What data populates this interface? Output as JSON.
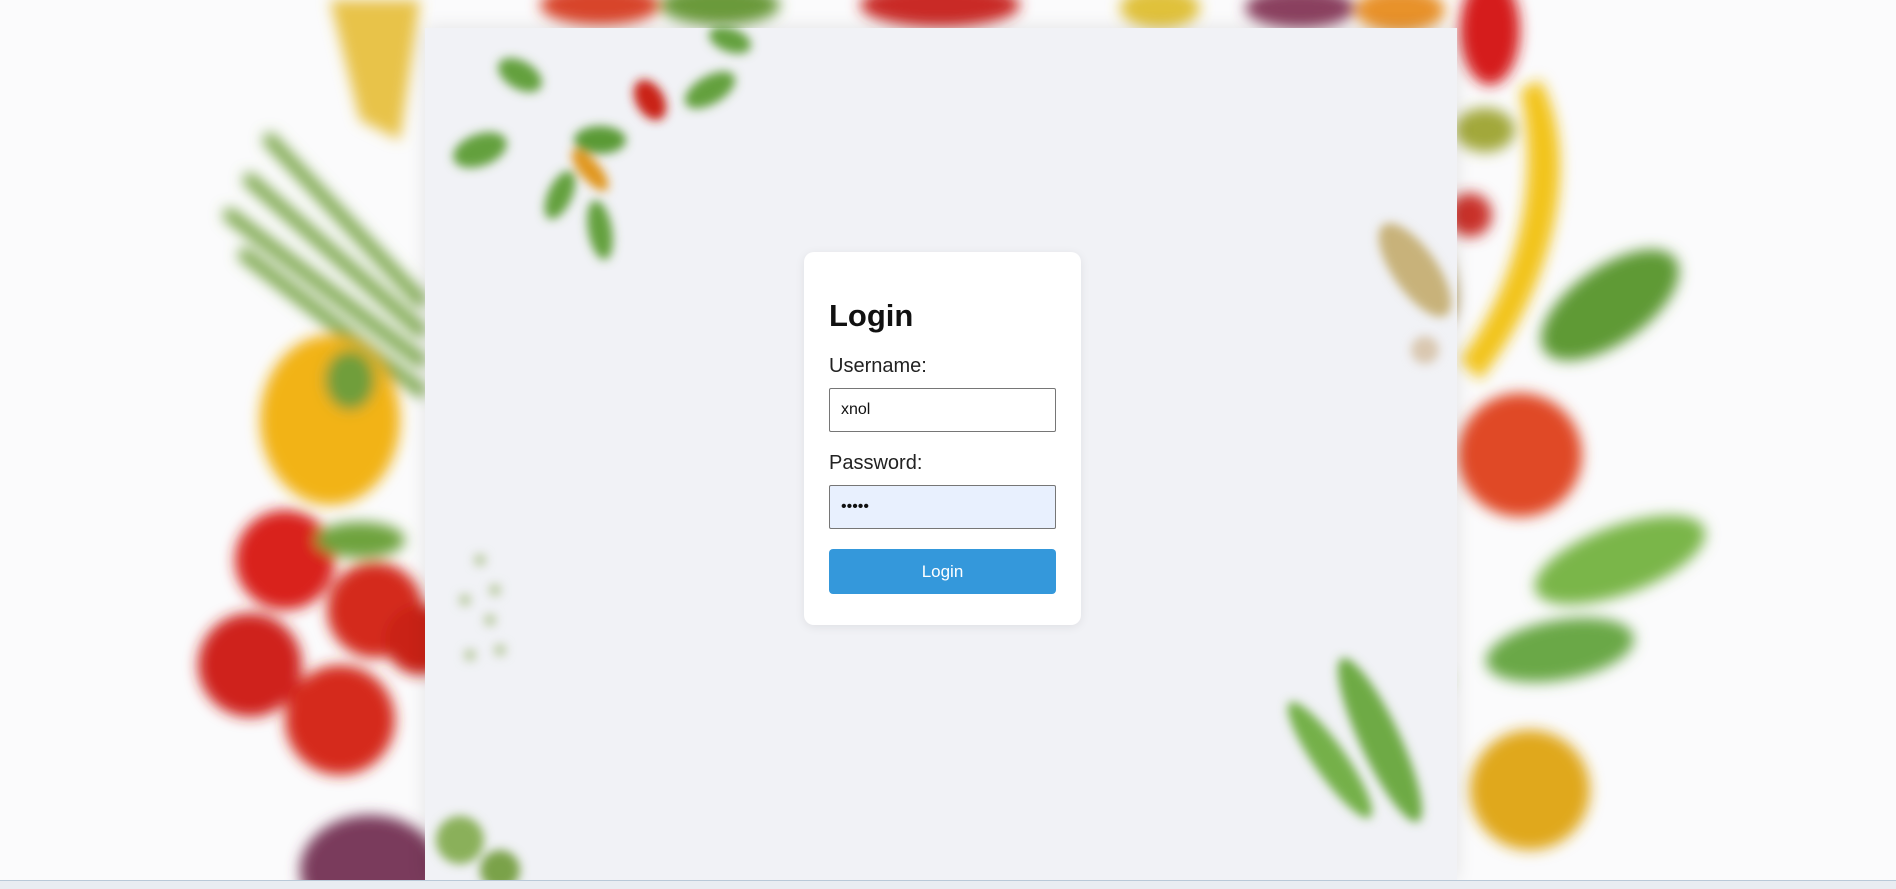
{
  "login": {
    "title": "Login",
    "username_label": "Username:",
    "username_value": "xnol",
    "password_label": "Password:",
    "password_value": "*****",
    "submit_label": "Login"
  },
  "colors": {
    "button": "#3498db",
    "card": "#ffffff",
    "autofill": "#e8f0fe",
    "paper": "#f1f2f6"
  },
  "background": {
    "description_icon": "vegetables-background-image"
  }
}
